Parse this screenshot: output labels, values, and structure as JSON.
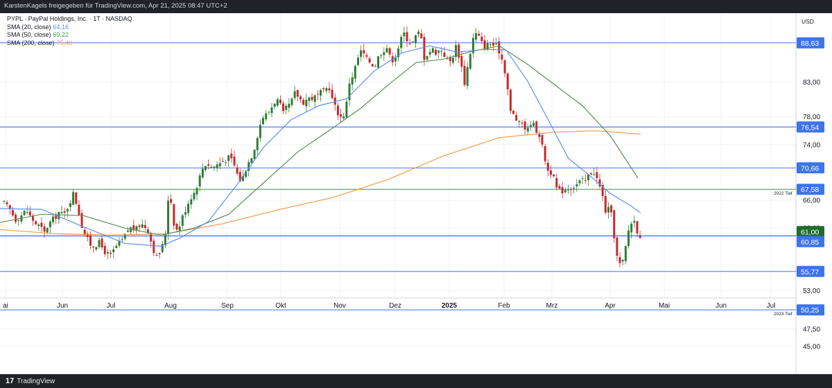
{
  "header": {
    "attribution": "KarstenKagels freigegeben für TradingView.com, Apr 21, 2025 08:47 UTC+2"
  },
  "footer": {
    "brand": "TradingView",
    "logo_mark": "17"
  },
  "legend": {
    "symbol": "PYPL · PayPal Holdings, Inc. · 1T · NASDAQ",
    "indicators": [
      {
        "label": "SMA (20, close)",
        "value": "64,16",
        "color": "#5b8ff0"
      },
      {
        "label": "SMA (50, close)",
        "value": "69,22",
        "color": "#43a047"
      },
      {
        "label": "SMA (200, close)",
        "value": "75,40",
        "color": "#f59a45"
      }
    ]
  },
  "currency": "USD",
  "colors": {
    "level_line": "#2962ff",
    "badge": "#3d74e8",
    "last_badge": "#1f6d2e",
    "up": "#2e7d32",
    "down": "#c62828",
    "sma20": "#5b8ff0",
    "sma50": "#5e8c5a",
    "sma200": "#f59a45"
  },
  "chart_data": {
    "type": "candlestick",
    "ylim": [
      43.5,
      92.5
    ],
    "y_ticks": [
      "45,00",
      "47,50",
      "50,25",
      "53,00",
      "55,77",
      "60,85",
      "62,00",
      "66,00",
      "67,58",
      "70,66",
      "74,00",
      "76,54",
      "78,00",
      "83,00",
      "88,63"
    ],
    "x_ticks": [
      "ai",
      "Jun",
      "Jul",
      "Aug",
      "Sep",
      "Okt",
      "Nov",
      "Dez",
      "2025",
      "Feb",
      "Mrz",
      "Apr",
      "Mai",
      "Jun",
      "Jul"
    ],
    "levels": [
      {
        "value": 88.63,
        "label": "88,63"
      },
      {
        "value": 76.54,
        "label": "76,54"
      },
      {
        "value": 70.66,
        "label": "70,66"
      },
      {
        "value": 67.58,
        "label": "67,58",
        "note": "2022 Tief"
      },
      {
        "value": 61.0,
        "label": "61,00",
        "current": true
      },
      {
        "value": 60.85,
        "label": "60,85"
      },
      {
        "value": 55.77,
        "label": "55,77"
      },
      {
        "value": 50.25,
        "label": "50,25",
        "note": "2023 Tief"
      }
    ],
    "close_path": [
      [
        0,
        66.4
      ],
      [
        8,
        65.3
      ],
      [
        15,
        64.6
      ],
      [
        22,
        63.2
      ],
      [
        30,
        63.8
      ],
      [
        38,
        64.6
      ],
      [
        44,
        63.6
      ],
      [
        52,
        62.6
      ],
      [
        58,
        62.2
      ],
      [
        64,
        61.3
      ],
      [
        70,
        62.6
      ],
      [
        78,
        63.4
      ],
      [
        85,
        64.3
      ],
      [
        92,
        63.8
      ],
      [
        100,
        65.7
      ],
      [
        106,
        67.0
      ],
      [
        112,
        65.0
      ],
      [
        118,
        62.4
      ],
      [
        124,
        60.7
      ],
      [
        130,
        59.7
      ],
      [
        136,
        59.4
      ],
      [
        142,
        60.0
      ],
      [
        148,
        59.1
      ],
      [
        154,
        58.3
      ],
      [
        160,
        58.0
      ],
      [
        166,
        59.2
      ],
      [
        172,
        59.8
      ],
      [
        178,
        60.4
      ],
      [
        184,
        61.7
      ],
      [
        190,
        62.1
      ],
      [
        196,
        61.7
      ],
      [
        202,
        62.6
      ],
      [
        208,
        62.4
      ],
      [
        214,
        61.6
      ],
      [
        220,
        59.3
      ],
      [
        226,
        57.8
      ],
      [
        232,
        58.7
      ],
      [
        238,
        60.7
      ],
      [
        242,
        66.2
      ],
      [
        246,
        66.4
      ],
      [
        250,
        63.0
      ],
      [
        256,
        61.5
      ],
      [
        262,
        63.3
      ],
      [
        268,
        64.8
      ],
      [
        274,
        66.3
      ],
      [
        280,
        67.1
      ],
      [
        286,
        68.7
      ],
      [
        292,
        70.6
      ],
      [
        298,
        71.4
      ],
      [
        306,
        70.7
      ],
      [
        314,
        71.2
      ],
      [
        322,
        71.7
      ],
      [
        330,
        72.1
      ],
      [
        336,
        71.6
      ],
      [
        342,
        69.8
      ],
      [
        348,
        68.6
      ],
      [
        354,
        70.5
      ],
      [
        360,
        71.8
      ],
      [
        366,
        73.2
      ],
      [
        372,
        75.7
      ],
      [
        378,
        77.9
      ],
      [
        384,
        78.3
      ],
      [
        390,
        79.1
      ],
      [
        396,
        80.2
      ],
      [
        402,
        80.4
      ],
      [
        408,
        78.3
      ],
      [
        414,
        79.4
      ],
      [
        420,
        80.0
      ],
      [
        426,
        81.6
      ],
      [
        432,
        80.6
      ],
      [
        438,
        80.1
      ],
      [
        444,
        80.7
      ],
      [
        450,
        80.7
      ],
      [
        456,
        80.9
      ],
      [
        462,
        81.4
      ],
      [
        468,
        81.6
      ],
      [
        474,
        82.6
      ],
      [
        480,
        80.2
      ],
      [
        486,
        78.8
      ],
      [
        492,
        77.9
      ],
      [
        498,
        78.6
      ],
      [
        504,
        83.0
      ],
      [
        510,
        84.3
      ],
      [
        516,
        86.4
      ],
      [
        522,
        87.6
      ],
      [
        528,
        86.3
      ],
      [
        534,
        85.9
      ],
      [
        540,
        85.2
      ],
      [
        546,
        86.7
      ],
      [
        552,
        87.6
      ],
      [
        558,
        88.0
      ],
      [
        564,
        86.0
      ],
      [
        570,
        86.7
      ],
      [
        576,
        88.4
      ],
      [
        582,
        90.1
      ],
      [
        588,
        89.1
      ],
      [
        594,
        88.5
      ],
      [
        600,
        89.6
      ],
      [
        606,
        90.3
      ],
      [
        612,
        86.5
      ],
      [
        618,
        87.3
      ],
      [
        624,
        87.7
      ],
      [
        630,
        87.2
      ],
      [
        636,
        87.8
      ],
      [
        642,
        86.7
      ],
      [
        648,
        85.8
      ],
      [
        652,
        86.4
      ],
      [
        658,
        88.2
      ],
      [
        664,
        86.1
      ],
      [
        670,
        82.9
      ],
      [
        676,
        86.1
      ],
      [
        682,
        89.2
      ],
      [
        688,
        90.1
      ],
      [
        694,
        88.7
      ],
      [
        700,
        88.0
      ],
      [
        706,
        88.6
      ],
      [
        712,
        88.3
      ],
      [
        718,
        88.0
      ],
      [
        724,
        86.3
      ],
      [
        730,
        83.9
      ],
      [
        736,
        78.7
      ],
      [
        742,
        78.2
      ],
      [
        748,
        76.9
      ],
      [
        754,
        77.2
      ],
      [
        760,
        75.7
      ],
      [
        766,
        77.4
      ],
      [
        772,
        76.4
      ],
      [
        778,
        75.4
      ],
      [
        784,
        72.8
      ],
      [
        790,
        70.3
      ],
      [
        796,
        70.0
      ],
      [
        802,
        67.8
      ],
      [
        808,
        67.2
      ],
      [
        814,
        67.6
      ],
      [
        820,
        67.8
      ],
      [
        826,
        67.9
      ],
      [
        832,
        68.3
      ],
      [
        838,
        68.8
      ],
      [
        844,
        68.7
      ],
      [
        850,
        69.8
      ],
      [
        856,
        70.3
      ],
      [
        862,
        68.8
      ],
      [
        868,
        67.0
      ],
      [
        874,
        64.2
      ],
      [
        880,
        65.0
      ],
      [
        886,
        60.8
      ],
      [
        890,
        57.8
      ],
      [
        894,
        56.8
      ],
      [
        898,
        57.0
      ],
      [
        902,
        59.0
      ],
      [
        906,
        61.5
      ],
      [
        910,
        62.7
      ],
      [
        914,
        63.3
      ],
      [
        918,
        61.9
      ],
      [
        922,
        61.0
      ],
      [
        926,
        61.0
      ]
    ],
    "sma20_path": [
      [
        0,
        64.8
      ],
      [
        60,
        64.7
      ],
      [
        120,
        62.2
      ],
      [
        180,
        59.8
      ],
      [
        232,
        59.4
      ],
      [
        260,
        60.6
      ],
      [
        300,
        62.9
      ],
      [
        340,
        68.0
      ],
      [
        380,
        73.6
      ],
      [
        420,
        77.6
      ],
      [
        460,
        79.6
      ],
      [
        500,
        80.6
      ],
      [
        540,
        84.6
      ],
      [
        580,
        87.2
      ],
      [
        620,
        88.2
      ],
      [
        660,
        87.3
      ],
      [
        700,
        87.7
      ],
      [
        730,
        87.6
      ],
      [
        760,
        83.3
      ],
      [
        790,
        77.7
      ],
      [
        820,
        72.0
      ],
      [
        850,
        69.6
      ],
      [
        880,
        67.0
      ],
      [
        910,
        65.2
      ],
      [
        924,
        64.2
      ]
    ],
    "sma50_path": [
      [
        0,
        62.8
      ],
      [
        60,
        64.0
      ],
      [
        120,
        63.8
      ],
      [
        180,
        62.0
      ],
      [
        232,
        61.0
      ],
      [
        280,
        62.0
      ],
      [
        330,
        64.0
      ],
      [
        380,
        68.5
      ],
      [
        430,
        73.0
      ],
      [
        480,
        76.4
      ],
      [
        520,
        79.2
      ],
      [
        560,
        82.6
      ],
      [
        600,
        85.8
      ],
      [
        640,
        86.3
      ],
      [
        680,
        87.4
      ],
      [
        720,
        88.2
      ],
      [
        760,
        85.6
      ],
      [
        800,
        82.6
      ],
      [
        840,
        79.6
      ],
      [
        880,
        75.3
      ],
      [
        920,
        69.2
      ]
    ],
    "sma200_path": [
      [
        0,
        61.8
      ],
      [
        80,
        61.2
      ],
      [
        160,
        61.0
      ],
      [
        240,
        61.2
      ],
      [
        320,
        62.6
      ],
      [
        400,
        64.6
      ],
      [
        480,
        66.4
      ],
      [
        560,
        69.0
      ],
      [
        640,
        72.4
      ],
      [
        720,
        75.0
      ],
      [
        800,
        75.8
      ],
      [
        860,
        76.0
      ],
      [
        924,
        75.5
      ]
    ]
  }
}
